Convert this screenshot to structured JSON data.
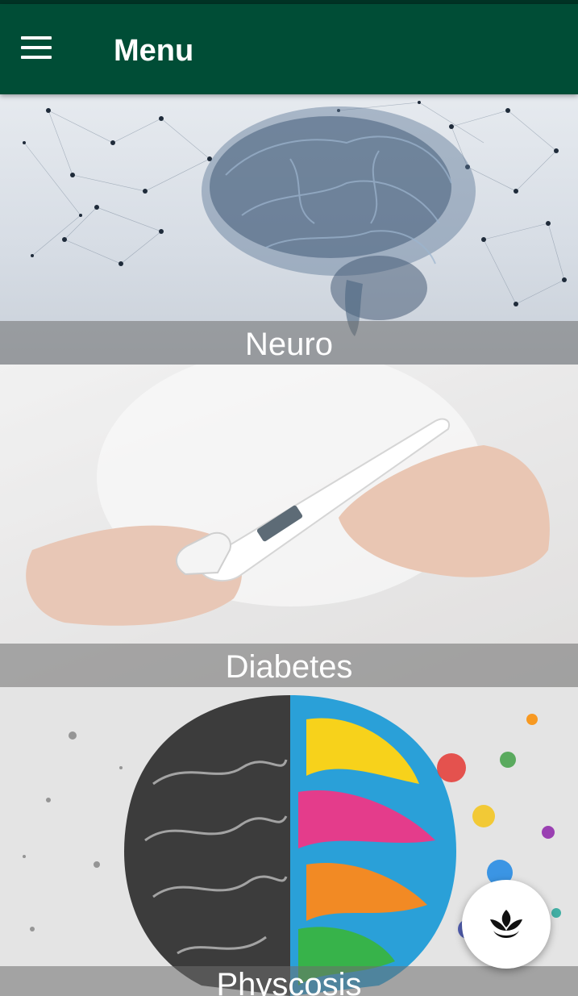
{
  "appbar": {
    "title": "Menu",
    "menu_icon": "hamburger-menu-icon"
  },
  "cards": [
    {
      "label": "Neuro",
      "image": "glass-brain-network-illustration"
    },
    {
      "label": "Diabetes",
      "image": "hands-holding-digital-thermometer-photo"
    },
    {
      "label": "Physcosis",
      "image": "split-brain-gray-colorful-illustration"
    }
  ],
  "fab": {
    "icon": "lotus-icon"
  },
  "colors": {
    "primary": "#004d36",
    "status_bar": "#003325",
    "caption_overlay": "rgba(110,110,110,0.55)"
  }
}
